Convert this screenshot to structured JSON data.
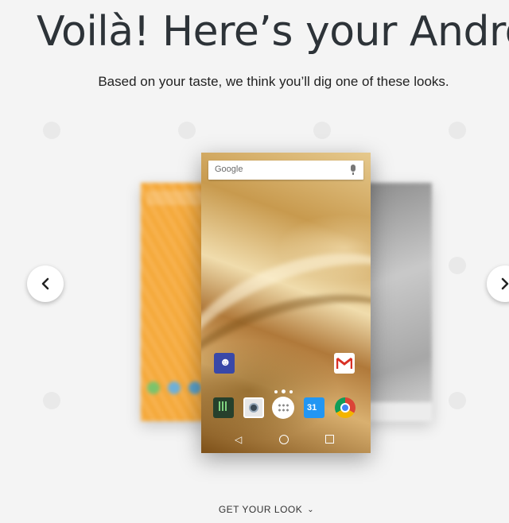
{
  "header": {
    "title": "Voilà! Here’s your Android.",
    "subtitle": "Based on your taste, we think you’ll dig one of these looks."
  },
  "carousel": {
    "prev_icon": "chevron-left-icon",
    "next_icon": "chevron-right-icon",
    "center_phone": {
      "search_label": "Google",
      "home_apps": [
        "contacts-icon",
        "gmail-icon"
      ],
      "dock_apps": [
        "music-icon",
        "camera-icon",
        "app-drawer-icon",
        "calendar-icon",
        "chrome-icon"
      ],
      "calendar_day": "31",
      "nav_buttons": [
        "back-icon",
        "home-icon",
        "recent-apps-icon"
      ]
    }
  },
  "cta": {
    "label": "GET YOUR LOOK",
    "icon": "chevron-down-icon"
  },
  "colors": {
    "background": "#f4f4f4",
    "title": "#2d3338",
    "gold_wallpaper": "#c89a4e",
    "left_theme": "#f7b24f",
    "right_theme": "#a7a7a7"
  }
}
